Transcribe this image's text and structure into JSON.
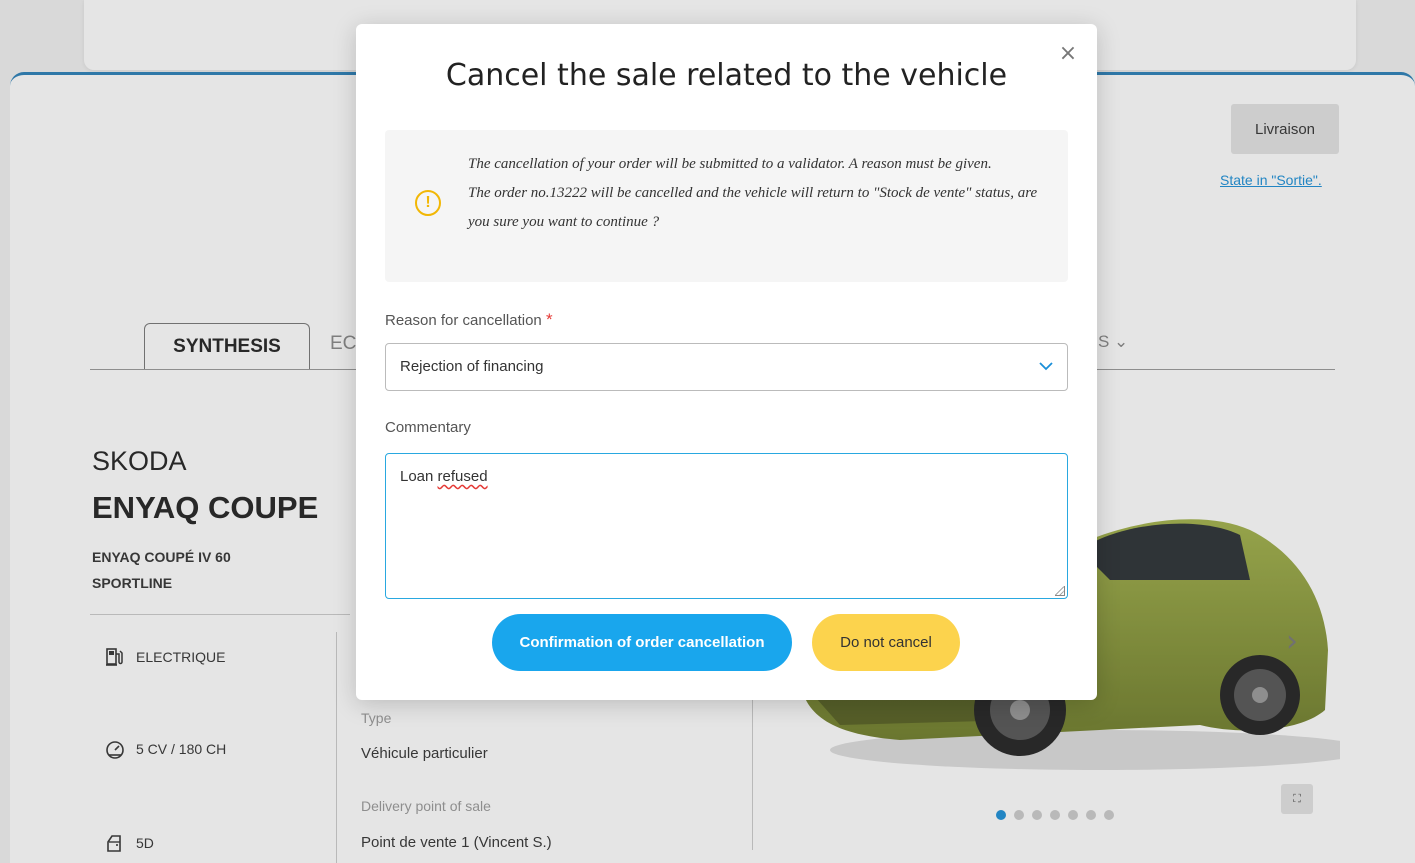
{
  "header": {
    "livraison_label": "Livraison",
    "state_link": "State in \"Sortie\"."
  },
  "tabs": {
    "synthesis": "SYNTHESIS",
    "second_partial": "EC",
    "more_suffix": "S ⌄"
  },
  "vehicle": {
    "brand": "SKODA",
    "model": "ENYAQ COUPE",
    "version_line1": "ENYAQ COUPÉ IV 60",
    "version_line2": "SPORTLINE",
    "features": [
      {
        "icon": "fuel-pump-icon",
        "label": "ELECTRIQUE"
      },
      {
        "icon": "speedometer-icon",
        "label": "5 CV / 180 CH"
      },
      {
        "icon": "car-door-icon",
        "label": "5D"
      }
    ],
    "details": [
      {
        "label": "Type",
        "value": "Véhicule particulier"
      },
      {
        "label": "Delivery point of sale",
        "value": "Point de vente 1 (Vincent S.)"
      }
    ]
  },
  "carousel": {
    "dot_count": 7,
    "active_index": 0
  },
  "modal": {
    "close_symbol": "×",
    "title": "Cancel the sale related to the vehicle",
    "warning_icon": "!",
    "warning_line1": "The cancellation of your order will be submitted to a validator. A reason must be given.",
    "warning_line2": "The order no.13222 will be cancelled and the vehicle will return to \"Stock de vente\" status, are you sure you want to continue ?",
    "reason_label": "Reason for cancellation",
    "required_mark": "*",
    "reason_value": "Rejection of financing",
    "commentary_label": "Commentary",
    "commentary_word1": "Loan",
    "commentary_word2": "refused",
    "confirm_label": "Confirmation of order cancellation",
    "cancel_label": "Do not cancel"
  },
  "colors": {
    "accent_blue": "#19a6ed",
    "accent_yellow": "#fcd34d",
    "warning_icon": "#f2b705",
    "required": "#e53935",
    "car_body": "#8a9a3a"
  }
}
